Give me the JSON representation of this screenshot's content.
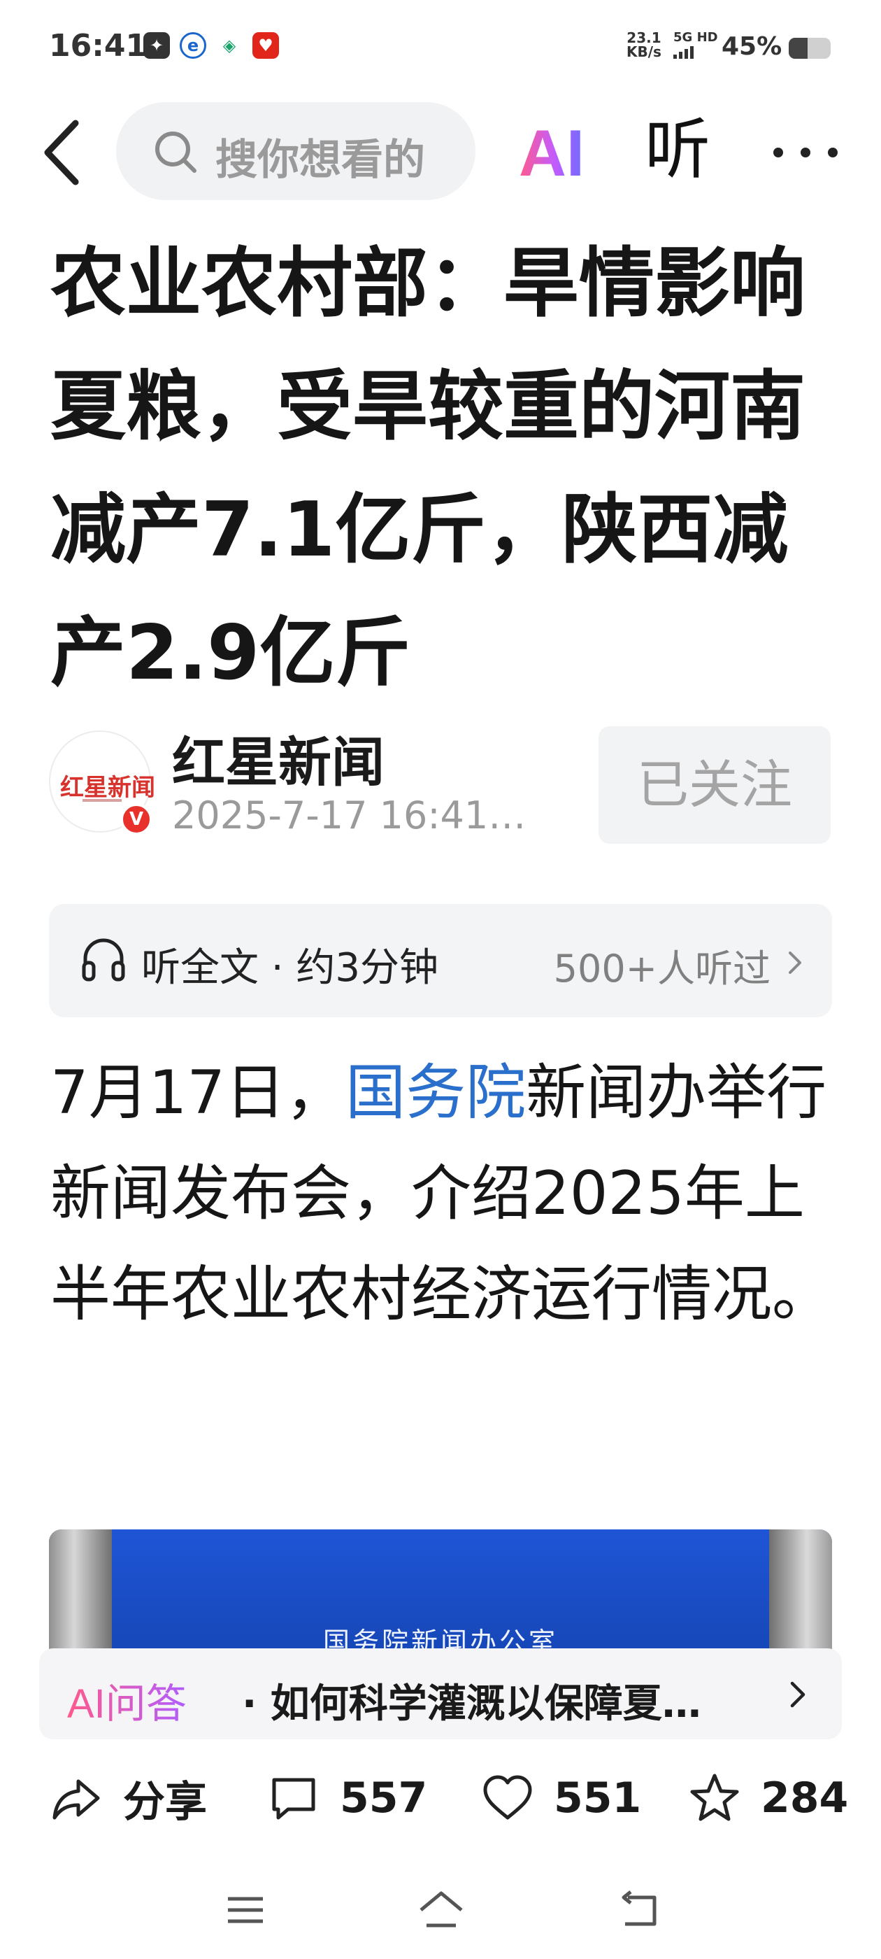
{
  "status_bar": {
    "time": "16:41",
    "net_speed_value": "23.1",
    "net_speed_unit": "KB/s",
    "signal_label": "5G HD",
    "battery_percent": "45%",
    "battery_level": 0.45
  },
  "header": {
    "search_placeholder": "搜你想看的",
    "ai_label": "AI",
    "listen_label": "听"
  },
  "article": {
    "title": "农业农村部：旱情影响夏粮，受旱较重的河南减产7.1亿斤，陕西减产2.9亿斤",
    "author": {
      "name": "红星新闻",
      "avatar_text": "红星新闻",
      "verified_mark": "V",
      "date": "2025-7-17 16:41…",
      "follow_label": "已关注"
    },
    "listen_bar": {
      "label": "听全文 · 约3分钟",
      "count": "500+人听过"
    },
    "body": {
      "part1": "7月17日，",
      "link": "国务院",
      "part2": "新闻办举行新闻发布会，介绍2025年上半年农业农村经济运行情况。"
    },
    "image_caption": "国务院新闻办公室"
  },
  "ai_qa": {
    "label": "AI问答",
    "question": "· 如何科学灌溉以保障夏…"
  },
  "actions": {
    "share_label": "分享",
    "comments": "557",
    "likes": "551",
    "favorites": "284"
  },
  "colors": {
    "link": "#2a6fcb",
    "ai_gradient_start": "#ff5a8c",
    "ai_gradient_end": "#6c6cff",
    "verified_red": "#e8312b"
  }
}
